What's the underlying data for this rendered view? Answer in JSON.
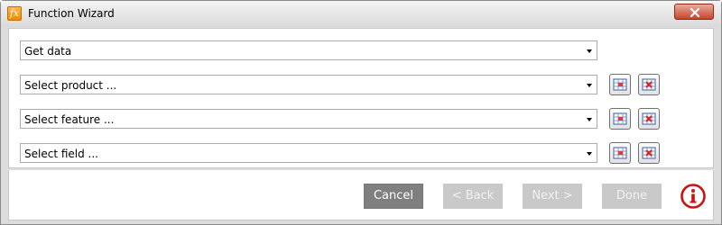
{
  "window": {
    "title": "Function Wizard",
    "app_icon_text": "fx"
  },
  "rows": [
    {
      "value": "Get data",
      "has_buttons": false
    },
    {
      "value": "Select product ...",
      "has_buttons": true
    },
    {
      "value": "Select feature ...",
      "has_buttons": true
    },
    {
      "value": "Select field ...",
      "has_buttons": true
    }
  ],
  "footer": {
    "cancel": "Cancel",
    "back": "< Back",
    "next": "Next >",
    "done": "Done"
  },
  "colors": {
    "close_red": "#c8442c",
    "info_red": "#cc1111",
    "button_gray": "#7f7f7f",
    "button_disabled": "#c9c9c9"
  }
}
